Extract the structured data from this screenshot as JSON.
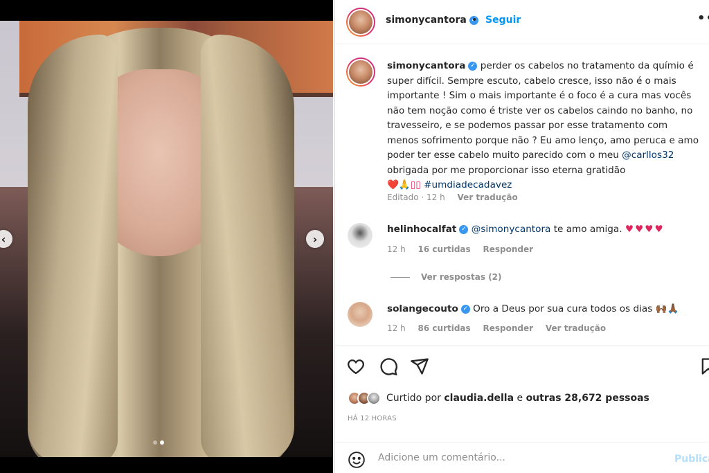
{
  "post": {
    "username": "simonycantora",
    "follow_label": "Seguir",
    "separator": "•",
    "more_label": "••",
    "carousel": {
      "prev_label": "‹",
      "next_label": "›",
      "count": 2,
      "active_index": 1
    }
  },
  "caption": {
    "username": "simonycantora",
    "text_1": "perder os cabelos no tratamento da químio é super difícil. Sempre escuto, cabelo cresce, isso não é o mais importante ! Sim o mais importante é o foco é a cura mas vocês não tem noção como é triste ver os cabelos caindo no banho, no travesseiro, e se podemos passar por esse tratamento com menos sofrimento porque não ? Eu amo lenço, amo peruca e amo poder ter esse cabelo muito parecido com o meu ",
    "mention": "@carllos32",
    "text_2": " obrigada por me proporcionar isso eterna gratidão",
    "emojis": "❤️🙏▯▯",
    "hashtag": "#umdiadecadavez",
    "edited_label": "Editado",
    "time": "12 h",
    "translate_label": "Ver tradução"
  },
  "comments": [
    {
      "username": "helinhocalfat",
      "mention": "@simonycantora",
      "text": " te amo amiga. ",
      "hearts": "♥♥♥♥",
      "time": "12 h",
      "likes": "16 curtidas",
      "reply_label": "Responder",
      "view_replies": "Ver respostas (2)"
    },
    {
      "username": "solangecouto",
      "text": "Oro a Deus por sua cura todos os dias 🙌🏾🙏🏾",
      "time": "12 h",
      "likes": "86 curtidas",
      "reply_label": "Responder",
      "translate_label": "Ver tradução"
    }
  ],
  "actions": {
    "icons": [
      "heart-icon",
      "comment-icon",
      "share-icon",
      "bookmark-icon"
    ],
    "liked_by_prefix": "Curtido por",
    "liked_by_user": "claudia.della",
    "liked_by_conj": "e",
    "liked_by_others": "outras 28,672 pessoas",
    "time_ago": "HÁ 12 HORAS"
  },
  "add_comment": {
    "placeholder": "Adicione um comentário...",
    "publish_label": "Publica"
  },
  "colors": {
    "link_blue": "#0095f6",
    "mention_blue": "#00376b",
    "verified_blue": "#3897f0",
    "heart_red": "#e0245e",
    "muted_gray": "#8e8e8e",
    "publish_disabled": "#b2dffc"
  }
}
